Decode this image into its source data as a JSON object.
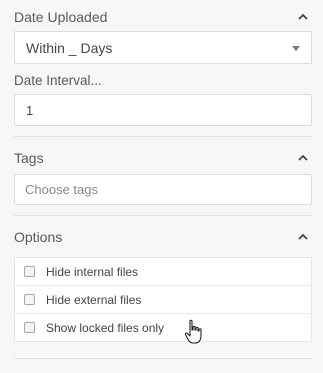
{
  "date_uploaded": {
    "title": "Date Uploaded",
    "selected": "Within _ Days"
  },
  "date_interval": {
    "label": "Date Interval...",
    "value": "1"
  },
  "tags": {
    "title": "Tags",
    "placeholder": "Choose tags"
  },
  "options": {
    "title": "Options",
    "items": [
      {
        "label": "Hide internal files",
        "checked": false
      },
      {
        "label": "Hide external files",
        "checked": false
      },
      {
        "label": "Show locked files only",
        "checked": false
      }
    ]
  },
  "icons": {
    "collapse": "chevron-up-icon",
    "dropdown": "caret-down-icon",
    "pointer": "hand-pointer-icon"
  }
}
